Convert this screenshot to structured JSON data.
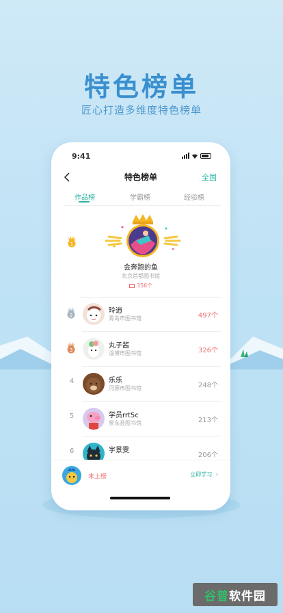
{
  "hero": {
    "title": "特色榜单",
    "subtitle": "匠心打造多维度特色榜单"
  },
  "status_bar": {
    "time": "9:41"
  },
  "nav": {
    "title": "特色榜单",
    "right": "全国"
  },
  "tabs": [
    {
      "label": "作品榜",
      "active": true
    },
    {
      "label": "学霸榜",
      "active": false
    },
    {
      "label": "经验榜",
      "active": false
    }
  ],
  "champion": {
    "rank": "1",
    "name": "会奔跑的鱼",
    "library": "北京首都图书馆",
    "count": "356个"
  },
  "ranking": [
    {
      "rank": "2",
      "name": "玲逍",
      "library": "青岛市图书馆",
      "count": "497个",
      "highlight": true
    },
    {
      "rank": "3",
      "name": "丸子酱",
      "library": "淄博市图书馆",
      "count": "326个",
      "highlight": true
    },
    {
      "rank": "4",
      "name": "乐乐",
      "library": "河源市图书馆",
      "count": "248个",
      "highlight": false
    },
    {
      "rank": "5",
      "name": "学员rrt5c",
      "library": "景东县图书馆",
      "count": "213个",
      "highlight": false
    },
    {
      "rank": "6",
      "name": "宇景雯",
      "library": "",
      "count": "206个",
      "highlight": false
    }
  ],
  "me": {
    "status": "未上榜",
    "action": "立即学习"
  },
  "watermark": {
    "part1": "谷普",
    "part2": "软件园"
  },
  "colors": {
    "accent": "#2ab3a3",
    "highlight": "#f06b6b",
    "hero": "#3a8fcf",
    "bg": "#c4e4f5"
  }
}
